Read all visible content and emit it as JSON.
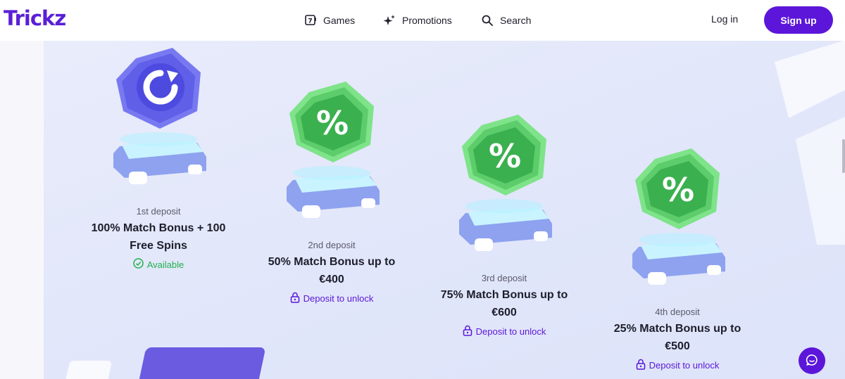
{
  "header": {
    "logo": "Trickz",
    "nav": [
      {
        "label": "Games",
        "icon": "slot-machine-icon"
      },
      {
        "label": "Promotions",
        "icon": "sparkle-icon"
      },
      {
        "label": "Search",
        "icon": "search-icon"
      }
    ],
    "login_label": "Log in",
    "signup_label": "Sign up"
  },
  "deposits": [
    {
      "label": "1st deposit",
      "title_line1": "100% Match Bonus + 100",
      "title_line2": "Free Spins",
      "status": "Available",
      "status_type": "available",
      "badge": "reload"
    },
    {
      "label": "2nd deposit",
      "title_line1": "50% Match Bonus up to",
      "title_line2": "€400",
      "status": "Deposit to unlock",
      "status_type": "locked",
      "badge": "percent"
    },
    {
      "label": "3rd deposit",
      "title_line1": "75% Match Bonus up to",
      "title_line2": "€600",
      "status": "Deposit to unlock",
      "status_type": "locked",
      "badge": "percent"
    },
    {
      "label": "4th deposit",
      "title_line1": "25% Match Bonus up to",
      "title_line2": "€500",
      "status": "Deposit to unlock",
      "status_type": "locked",
      "badge": "percent"
    }
  ],
  "colors": {
    "brand": "#5b16d9",
    "available": "#22b14c",
    "badge_blue": "#6e6ff0",
    "badge_green": "#5fd16f"
  }
}
